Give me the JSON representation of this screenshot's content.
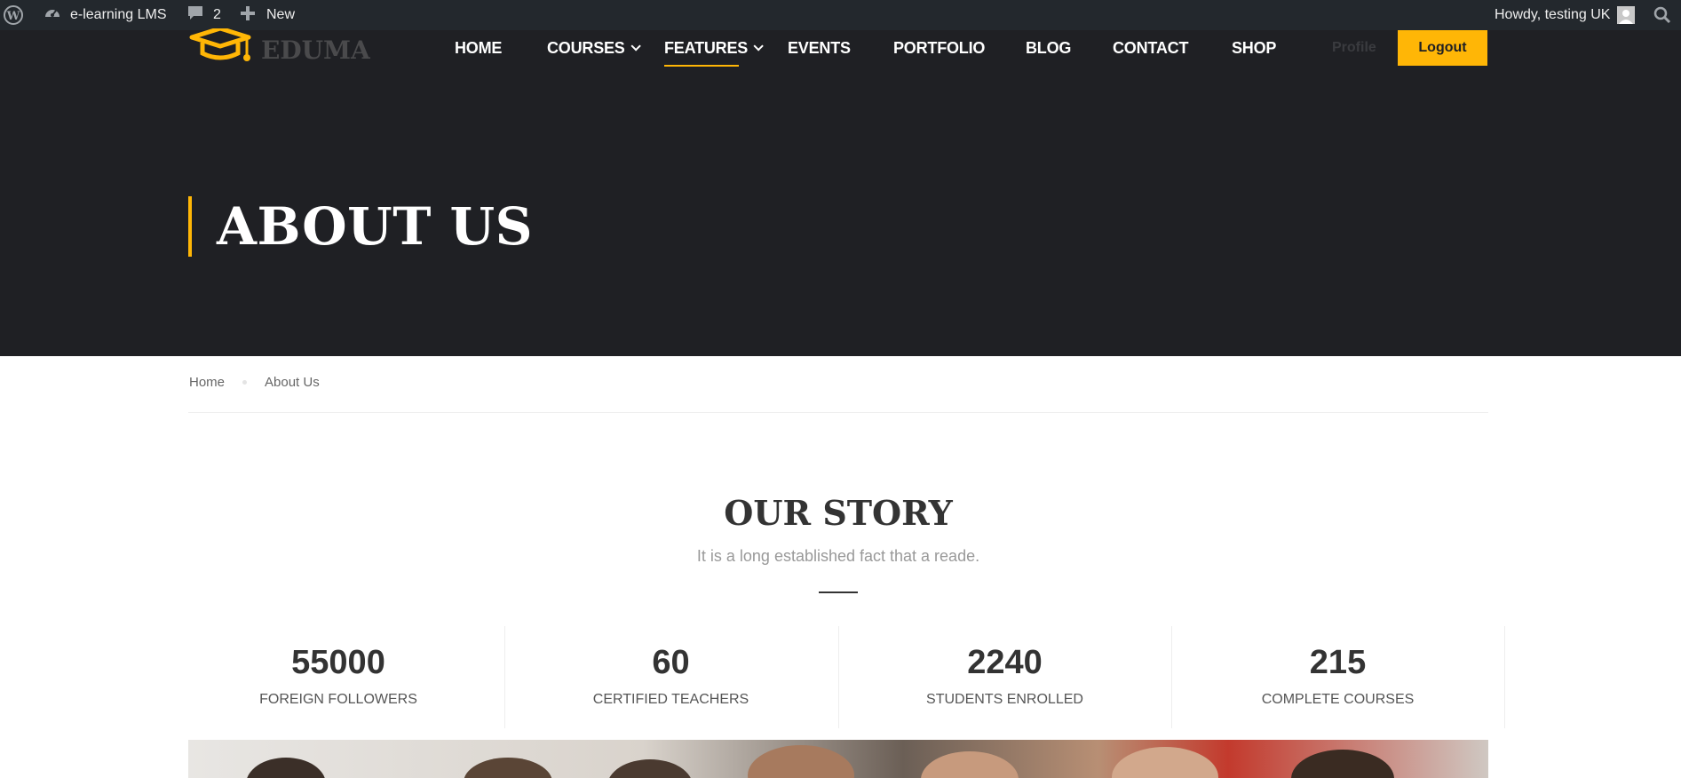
{
  "admin_bar": {
    "site_name": "e-learning LMS",
    "comments_count": "2",
    "new_label": "New",
    "greeting": "Howdy, testing UK"
  },
  "header": {
    "logo_text": "EDUMA",
    "nav": [
      {
        "label": "HOME"
      },
      {
        "label": "COURSES"
      },
      {
        "label": "FEATURES"
      },
      {
        "label": "EVENTS"
      },
      {
        "label": "PORTFOLIO"
      },
      {
        "label": "BLOG"
      },
      {
        "label": "CONTACT"
      },
      {
        "label": "SHOP"
      }
    ],
    "profile_label": "Profile",
    "logout_label": "Logout",
    "active_nav": "FEATURES"
  },
  "hero": {
    "title": "ABOUT US"
  },
  "breadcrumb": {
    "home": "Home",
    "current": "About Us"
  },
  "story": {
    "title": "OUR STORY",
    "subtitle": "It is a long established fact that a reade."
  },
  "stats": [
    {
      "value": "55000",
      "label": "FOREIGN FOLLOWERS"
    },
    {
      "value": "60",
      "label": "CERTIFIED TEACHERS"
    },
    {
      "value": "2240",
      "label": "STUDENTS ENROLLED"
    },
    {
      "value": "215",
      "label": "COMPLETE COURSES"
    }
  ],
  "colors": {
    "accent": "#ffb606",
    "hero_bg": "#1f2024",
    "admin_bar_bg": "#23282d"
  }
}
